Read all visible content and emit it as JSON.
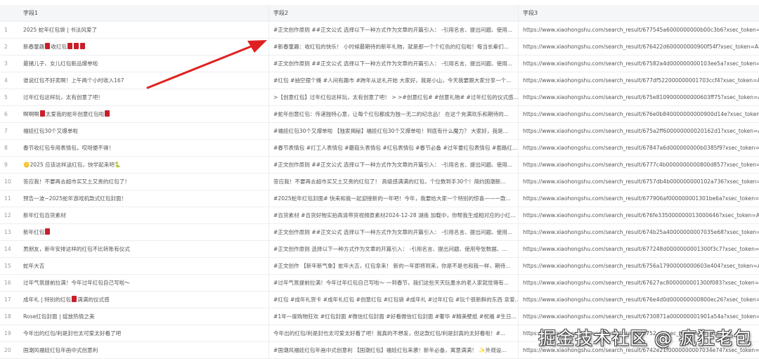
{
  "headers": [
    "字段1",
    "字段2",
    "字段3"
  ],
  "rows": [
    {
      "n": "1",
      "f1": "2025 蛇年红包袋 | 书法风爱了",
      "f2": "#正文创作原则 ##正文公式 选择以下一种方式作为文章的开篇引入： -引用名言、提出问题、使用...",
      "f3": "https://www.xiaohongshu.com/search_result/677545a6000000000b00c3b6?xsec_token=ABQxwXB..."
    },
    {
      "n": "2",
      "f1": "新春童趣🧧收红包🧧🧧🧧",
      "f2": "#新春童趣：收红包的快乐！ 小时候最期待的新年礼物，就是那一个个红色的红包啦！每当长辈们...",
      "f3": "https://www.xiaohongshu.com/search_result/676422d600000000900f54f?xsec_token=AB7P7R5g..."
    },
    {
      "n": "3",
      "f1": "最猪儿子、女儿红包新品爆单啦",
      "f2": "#正文创作原则 ##正文公式 选择以下一种方式作为文章的开篇引入： -引用名言、提出问题、使用...",
      "f3": "https://www.xiaohongshu.com/search_result/67582a4d000000000103ee5a?xsec_token=ABwZSXX..."
    },
    {
      "n": "4",
      "f1": "谁说红包不好卖啊！上午两个小时收入167",
      "f2": "#红包 #抽空摆个摊 #人间有趣市 #跨年从这礼开始 大家好，我是小山，今天我要跟大家分享一个...",
      "f3": "https://www.xiaohongshu.com/search_result/677df522000000001703ccf4?xsec_token=ABz89hCIP..."
    },
    {
      "n": "5",
      "f1": "过年红包这样玩，太有创意了吧！",
      "f2": ">【创意红包】过年红包这样玩，太有创意了吧！ > >#创意红包# #创意礼物# #过年红包的仪式感...",
      "f3": "https://www.xiaohongshu.com/search_result/675e8109000000000603ff75?xsec_token=ABWtkWm..."
    },
    {
      "n": "6",
      "f1": "啊啊啊🧧太爱我的蛇年创意红包啦🧧",
      "f2": "#蛇年创意红包：传递独特心意，让每个红包都成为独一无二的纪念品！ 在这个充满欢乐和期待的...",
      "f3": "https://www.xiaohongshu.com/search_result/676e0b840000000000900d14e?xsec_token=ABkDjsO..."
    },
    {
      "n": "7",
      "f1": "福娃红包30个又爆单啦",
      "f2": "#福娃红包30个又爆单啦 【独家揭秘】福娃红包30个又爆单啦！到底有什么魔力？ 大家好，我是...",
      "f3": "https://www.xiaohongshu.com/search_result/675a2ff600000000020162d1?xsec_token=ABb0uftqG..."
    },
    {
      "n": "8",
      "f1": "春节收红包专用表情包，哎呀便不得！",
      "f2": "#春节表情包 #打工人表情包 #蘑菇头表情包 #红包表情包 #春节必备 #过年要红包表情包 #套路红...",
      "f3": "https://www.xiaohongshu.com/search_result/67847a6d000000000b0385f9?xsec_token=AB1Tf7cPI..."
    },
    {
      "n": "9",
      "f1": "🪙2025 应该这样送红包，快学起来吧🐍",
      "f2": "#正文创作原则 ##正文公式 选择以下一种方式作为文章的开篇引入： -引用名言、提出问题、使用...",
      "f3": "https://www.xiaohongshu.com/search_result/6777c4b0000000000800d857?xsec_token=ABgO8OY..."
    },
    {
      "n": "10",
      "f1": "答应我！不要再去超市买又土又贵的红包了！",
      "f2": "答应我！不要再去超市买又土又贵的红包了！ 高级感满满的红包，个位数到手30个！简约国潮新...",
      "f3": "https://www.xiaohongshu.com/search_result/6757db4b000000000102a736?xsec_token=ABtOjLa0..."
    },
    {
      "n": "11",
      "f1": "预告一波~2025蛇年游戏机款式红包封面！",
      "f2": "#2025蛇年红包封面# 快来和我一起迎接新的一年吧！今年，我要给大家一个特别的惊喜——一款...",
      "f3": "https://www.xiaohongshu.com/search_result/677906af000000001301be6a?xsec_token=ABa8Yryw..."
    },
    {
      "n": "12",
      "f1": "新年红包百货素材",
      "f2": "#百货素材 #百货好物实拍高清带货视频原素材2024-12-28 湖南 加载中，你帮我生成相对应的小红...",
      "f3": "https://www.xiaohongshu.com/search_result/676fe335000000013000646?xsec_token=ABj_lkQnz..."
    },
    {
      "n": "13",
      "f1": "新年红包🧧",
      "f2": "#正文创作原则 ##正文公式 选择以下一种方式作为文章的开篇引入： -引用名言、提出问题、使用...",
      "f3": "https://www.xiaohongshu.com/search_result/674b25a40000000007035e68?xsec_token=ABj4F5FP..."
    },
    {
      "n": "14",
      "f1": "男朋友，新年安排这样的红包不比转账有仪式",
      "f2": "#正文创作原则 选择以下一种方式作为文章的开篇引入： -引用名言、提出问题、使用夸张数据、...",
      "f3": "https://www.xiaohongshu.com/search_result/677248d0000000001300f3c7?xsec_token=ABlAhikU..."
    },
    {
      "n": "15",
      "f1": "蛇年大吉",
      "f2": "#正文创作 【新年新气象】蛇年大吉，红包拿来！ 新的一年即将到来，你是不是也和我一样，期待...",
      "f3": "https://www.xiaohongshu.com/search_result/6756a17900000000603e404?xsec_token=ABd4b8N..."
    },
    {
      "n": "16",
      "f1": "过年气氛提前拉满！今年过年红包自己写啦～",
      "f2": "#过年气氛提前拉满！今年过年红包自己写啦～ 一到春节，我们这些天天玩墨水的老人家就觉得有...",
      "f3": "https://www.xiaohongshu.com/search_result/67627ac8000000001300f083?xsec_token=ABkPv93w..."
    },
    {
      "n": "17",
      "f1": "成年礼 | 特别的红包🧧满满的仪式感",
      "f2": "#红包 #成年礼贺卡 #成年礼红包 #创意红包 #红包袋 #成年礼 #过年红包 #玩个很新鲜的东西 亲爱...",
      "f3": "https://www.xiaohongshu.com/search_result/676e4d0d000000000800ec26?xsec_token=ABkDjsO..."
    },
    {
      "n": "18",
      "f1": "Rose红包封面 | 绽放热情之美",
      "f2": "#1年一度购物狂欢 #红包封面 #微信红包封面 #好看微信红包封面 #奢华 #精美壁纸 #祝福 #生日...",
      "f3": "https://www.xiaohongshu.com/search_result/6730871a000000001901a54a?xsec_token=ABoNk7E..."
    },
    {
      "n": "19",
      "f1": "今年出的红包/利是封也太可爱太好看了吧",
      "f2": "今年出的红包/利是封也太可爱太好看了吧！我真的不想发，但这款红包/利是封真的太好看啦！#...",
      "f3": "https://www.xiaohongshu.com/search_result/6752...?xsec_token=AB...xpP..."
    },
    {
      "n": "20",
      "f1": "国潮风福娃红包年画中式创意利",
      "f2": "#国潮风福娃红包年画中式创意利 【国潮红包】福娃红包来袭！新年必备，寓意满满！ ✨外观设...",
      "f3": "https://www.xiaohongshu.com/search_result/6742e21f0000000007034e74?xsec_token=ABglbzssZ..."
    }
  ],
  "watermark": "掘金技术社区 @ 疯狂老包",
  "colors": {
    "arrow": "#e02020",
    "envelope": "#c8202a",
    "header_bg": "#f5f6f8"
  }
}
